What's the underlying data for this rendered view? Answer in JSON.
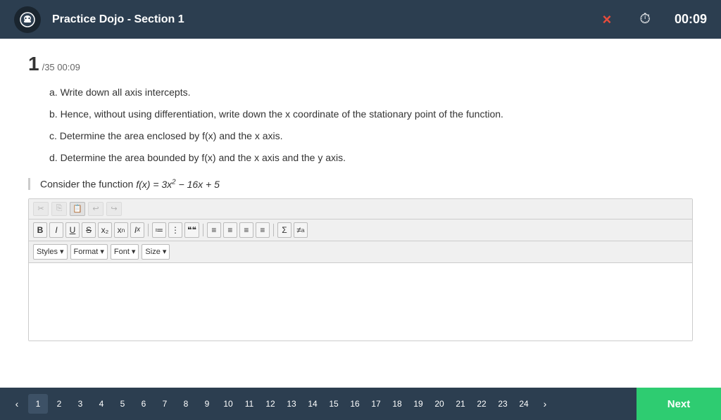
{
  "header": {
    "title": "Practice Dojo - Section 1",
    "timer": "00:09",
    "close_label": "×",
    "logo_alt": "ninja-logo"
  },
  "question": {
    "number": "1",
    "total": "35",
    "time": "00:09",
    "parts": [
      {
        "id": "a",
        "text": "a. Write down all axis intercepts."
      },
      {
        "id": "b",
        "text": "b. Hence, without using differentiation, write down the x coordinate of the stationary point of the function."
      },
      {
        "id": "c",
        "text": "c. Determine the area enclosed by f(x) and the x axis."
      },
      {
        "id": "d",
        "text": "d. Determine the area bounded by f(x) and the x axis and the y axis."
      }
    ],
    "context": "Consider the function f(x) = 3x² − 16x + 5"
  },
  "toolbar": {
    "top_icons": [
      "✂",
      "⎘",
      "📋",
      "↩",
      "↪"
    ],
    "format_buttons": [
      "B",
      "I",
      "U",
      "S",
      "x₂",
      "xⁿ",
      "Iₓ"
    ],
    "special_buttons": [
      "❝❝",
      "❝❝",
      "99",
      "≡",
      "≡",
      "≡",
      "≡",
      "Σ",
      "≠"
    ],
    "dropdowns": [
      {
        "name": "styles",
        "label": "Styles",
        "options": [
          "Styles"
        ]
      },
      {
        "name": "format",
        "label": "Format",
        "options": [
          "Format"
        ]
      },
      {
        "name": "font",
        "label": "Font",
        "options": [
          "Font"
        ]
      },
      {
        "name": "size",
        "label": "Size",
        "options": [
          "Size"
        ]
      }
    ]
  },
  "pagination": {
    "current": 1,
    "total": 24,
    "pages": [
      1,
      2,
      3,
      4,
      5,
      6,
      7,
      8,
      9,
      10,
      11,
      12,
      13,
      14,
      15,
      16,
      17,
      18,
      19,
      20,
      21,
      22,
      23,
      24
    ]
  },
  "next_button": {
    "label": "Next"
  }
}
